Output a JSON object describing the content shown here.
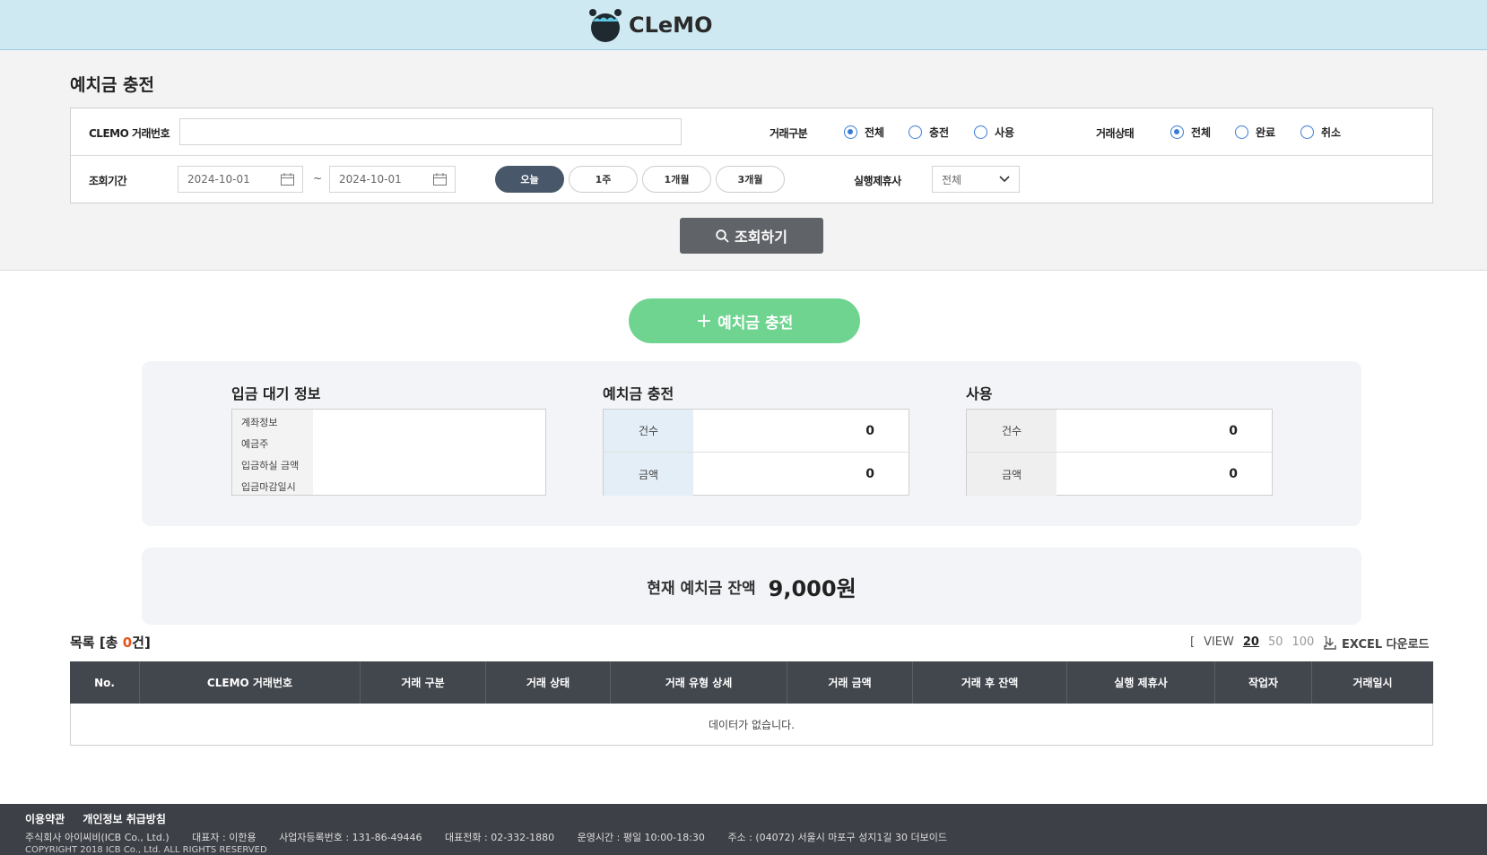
{
  "header": {
    "logo_text": "CLeMO"
  },
  "page": {
    "title": "예치금 충전"
  },
  "filters": {
    "txn_no_label": "CLEMO 거래번호",
    "txn_no_value": "",
    "txn_type_label": "거래구분",
    "txn_type_options": [
      "전체",
      "충전",
      "사용"
    ],
    "txn_type_selected": "전체",
    "txn_status_label": "거래상태",
    "txn_status_options": [
      "전체",
      "완료",
      "취소"
    ],
    "txn_status_selected": "전체",
    "period_label": "조회기간",
    "date_from": "2024-10-01",
    "date_to": "2024-10-01",
    "date_sep": "~",
    "quick_ranges": [
      "오늘",
      "1주",
      "1개월",
      "3개월"
    ],
    "quick_range_selected": "오늘",
    "partner_label": "실행제휴사",
    "partner_value": "전체"
  },
  "search_button": "조회하기",
  "charge_button": "예치금 충전",
  "deposit_wait": {
    "title": "입금 대기 정보",
    "labels": [
      "계좌정보",
      "예금주",
      "입금하실 금액",
      "입금마감일시"
    ]
  },
  "charge_summary": {
    "title": "예치금 충전",
    "count_label": "건수",
    "count_value": "0",
    "amount_label": "금액",
    "amount_value": "0"
  },
  "use_summary": {
    "title": "사용",
    "count_label": "건수",
    "count_value": "0",
    "amount_label": "금액",
    "amount_value": "0"
  },
  "balance": {
    "label": "현재 예치금 잔액",
    "value": "9,000원"
  },
  "list": {
    "title_prefix": "목록 [총 ",
    "count": "0",
    "title_suffix": "건]",
    "view_open": "[",
    "view_label": "VIEW",
    "view_options": [
      "20",
      "50",
      "100"
    ],
    "view_close": "]",
    "excel_label": "EXCEL 다운로드",
    "columns": [
      "No.",
      "CLEMO 거래번호",
      "거래 구분",
      "거래 상태",
      "거래 유형 상세",
      "거래 금액",
      "거래 후 잔액",
      "실행 제휴사",
      "작업자",
      "거래일시"
    ],
    "empty_text": "데이터가 없습니다."
  },
  "footer": {
    "links": [
      "이용약관",
      "개인정보 취급방침"
    ],
    "info": [
      "주식회사 아이씨비(ICB Co., Ltd.)",
      "대표자 : 이한용",
      "사업자등록번호 : 131-86-49446",
      "대표전화 : 02-332-1880",
      "운영시간 : 평일 10:00-18:30",
      "주소 : (04072) 서울시 마포구 성지1길 30 더보이드"
    ],
    "copyright": "COPYRIGHT 2018 ICB Co., Ltd. ALL RIGHTS RESERVED"
  },
  "colors": {
    "header_bg": "#cfe9f2",
    "accent_green": "#6fd490",
    "radio_blue": "#3a7bd5",
    "table_head": "#42464d",
    "count_orange": "#e8541f"
  }
}
